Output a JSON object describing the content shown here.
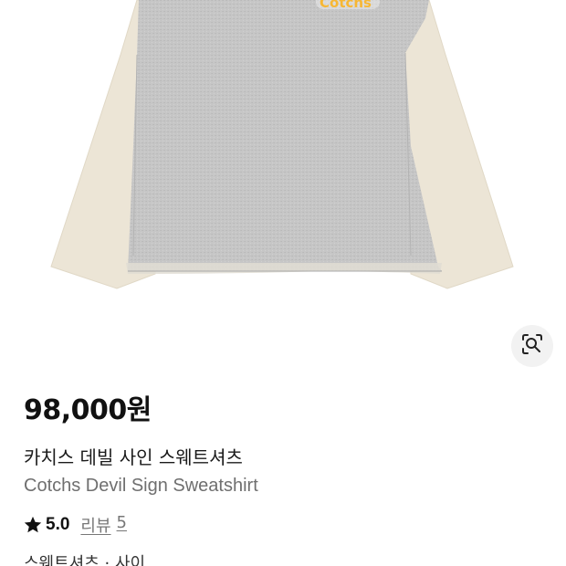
{
  "product": {
    "image_alt": "Cotchs Devil Sign Sweatshirt product photo",
    "logo_text": "Cotchs",
    "price": "98,000원",
    "name_ko": "카치스 데빌 사인 스웨트셔츠",
    "name_en": "Cotchs Devil Sign Sweatshirt",
    "rating": "5.0",
    "reviews_label": "리뷰",
    "reviews_count": "5",
    "category": "스웨트셔츠 · 사이"
  },
  "icons": {
    "visual_search": "visual-search-icon",
    "rating": "star-icon"
  },
  "colors": {
    "body_gray": "#c4c4c4",
    "sleeve_cream": "#ece5d6",
    "price_text": "#111111",
    "subtitle_text": "#6f6f6f",
    "lens_bg": "#f2f2f2"
  }
}
